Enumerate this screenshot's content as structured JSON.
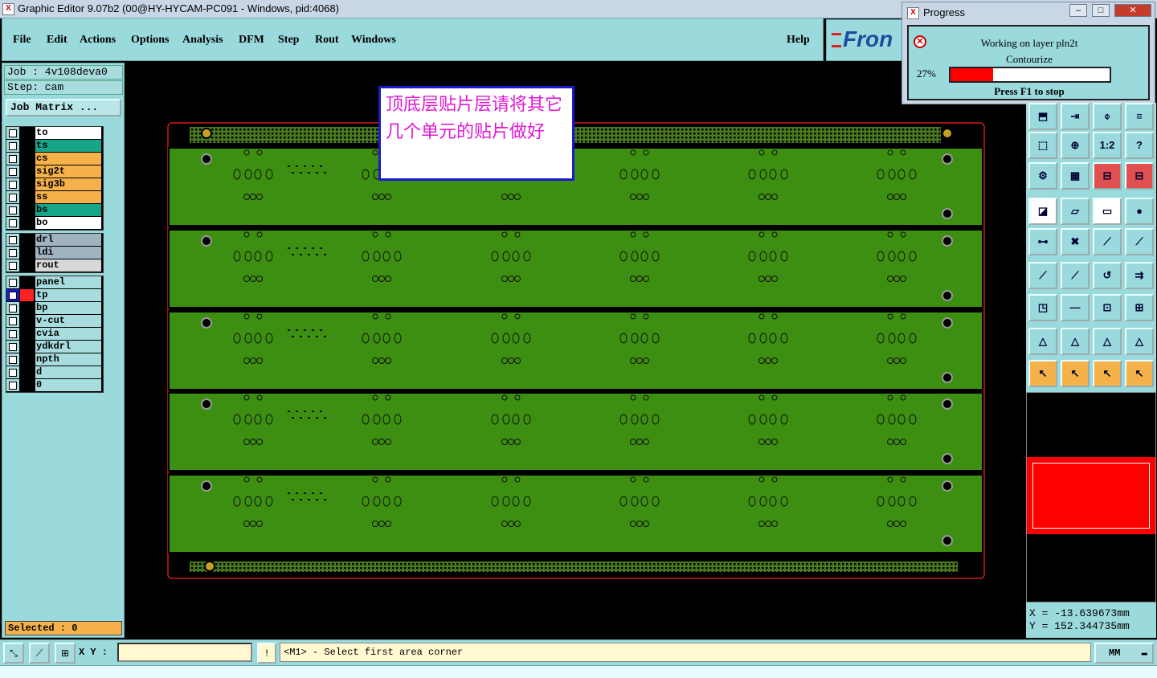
{
  "window": {
    "title": "Graphic Editor 9.07b2 (00@HY-HYCAM-PC091 - Windows, pid:4068)"
  },
  "menu": {
    "items": [
      "File",
      "Edit",
      "Actions",
      "Options",
      "Analysis",
      "DFM",
      "Step",
      "Rout",
      "Windows"
    ],
    "help": "Help"
  },
  "brand": {
    "logo_text": "Fron"
  },
  "job": {
    "job_line": "Job : 4v108deva0",
    "step_line": "Step: cam",
    "matrix_button": "Job Matrix ..."
  },
  "layers": {
    "group1": [
      {
        "name": "to",
        "color": "#ffffff"
      },
      {
        "name": "ts",
        "color": "#17a589"
      },
      {
        "name": "cs",
        "color": "#f5b14a"
      },
      {
        "name": "sig2t",
        "color": "#f5b14a"
      },
      {
        "name": "sig3b",
        "color": "#f5b14a"
      },
      {
        "name": "ss",
        "color": "#f5b14a"
      },
      {
        "name": "bs",
        "color": "#17a589"
      },
      {
        "name": "bo",
        "color": "#ffffff"
      }
    ],
    "group2": [
      {
        "name": "drl",
        "color": "#9fb3c0"
      },
      {
        "name": "ldi",
        "color": "#9fb3c0"
      },
      {
        "name": "rout",
        "color": "#d8d8d8"
      }
    ],
    "group3": [
      {
        "name": "panel",
        "color": "#a8dcde"
      },
      {
        "name": "tp",
        "color": "#a8dcde"
      },
      {
        "name": "bp",
        "color": "#a8dcde"
      },
      {
        "name": "v-cut",
        "color": "#a8dcde"
      },
      {
        "name": "cvia",
        "color": "#a8dcde"
      },
      {
        "name": "ydkdrl",
        "color": "#a8dcde"
      },
      {
        "name": "npth",
        "color": "#a8dcde"
      },
      {
        "name": "d",
        "color": "#a8dcde"
      },
      {
        "name": "0",
        "color": "#a8dcde"
      }
    ]
  },
  "selected": {
    "label": "Selected : 0"
  },
  "note": {
    "text": "顶底层贴片层请将其它几个单元的贴片做好"
  },
  "progress": {
    "title": "Progress",
    "working": "Working on layer pln2t",
    "task": "Contourize",
    "percent_label": "27%",
    "fraction": 0.27,
    "stop_hint": "Press F1 to stop"
  },
  "toolbar": {
    "ratio_label": "1:2",
    "help_label": "?"
  },
  "coords": {
    "x_line": "X  =  -13.639673mm",
    "y_line": "Y  =  152.344735mm"
  },
  "bottom": {
    "xy_label": "X Y :",
    "xy_value": "",
    "message": "<M1> - Select first area corner",
    "unit": "MM"
  },
  "colors": {
    "board_green": "#3c8f10",
    "board_outline": "#cc1a1a",
    "pad_color": "#c8a020",
    "progress_fill": "#ff0000",
    "minimap_fill": "#ff0000"
  }
}
